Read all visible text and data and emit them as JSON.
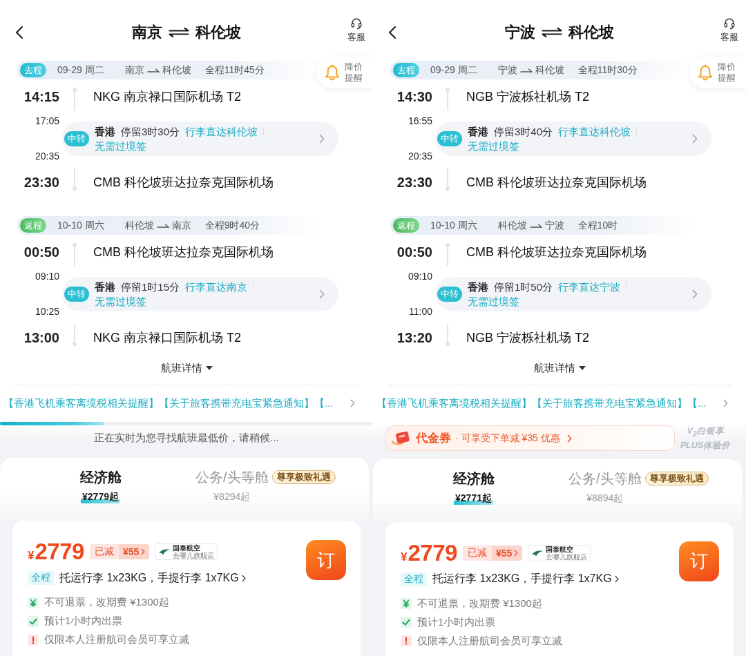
{
  "panels": [
    {
      "header": {
        "origin": "南京",
        "destination": "科伦坡",
        "service_label": "客服"
      },
      "price_alert": {
        "label": "降价提醒"
      },
      "legs": [
        {
          "kind": "outbound",
          "tag": "去程",
          "date": "09-29 周二",
          "route_from": "南京",
          "route_to": "科伦坡",
          "duration": "全程11时45分",
          "departure": {
            "time": "14:15",
            "airport": "NKG 南京禄口国际机场 T2"
          },
          "transfer": {
            "badge": "中转",
            "arrive_time": "17:05",
            "depart_time": "20:35",
            "city": "香港",
            "stay": "停留3时30分",
            "notes": [
              "行李直达科伦坡",
              "无需过境签"
            ]
          },
          "arrival": {
            "time": "23:30",
            "airport": "CMB 科伦坡班达拉奈克国际机场"
          }
        },
        {
          "kind": "return",
          "tag": "返程",
          "date": "10-10 周六",
          "route_from": "科伦坡",
          "route_to": "南京",
          "duration": "全程9时40分",
          "departure": {
            "time": "00:50",
            "airport": "CMB 科伦坡班达拉奈克国际机场"
          },
          "transfer": {
            "badge": "中转",
            "arrive_time": "09:10",
            "depart_time": "10:25",
            "city": "香港",
            "stay": "停留1时15分",
            "notes": [
              "行李直达南京",
              "无需过境签"
            ]
          },
          "arrival": {
            "time": "13:00",
            "airport": "NKG 南京禄口国际机场 T2"
          }
        }
      ],
      "details_link": "航班详情",
      "notice": "【香港飞机乘客离境税相关提醒】【关于旅客携带充电宝紧急通知】【...",
      "status": {
        "kind": "loading",
        "level": 0.28,
        "message": "正在实时为您寻找航班最低价，请稍候..."
      },
      "cabins": [
        {
          "name": "经济舱",
          "price": "¥2779起",
          "selected": true
        },
        {
          "name": "公务/头等舱",
          "price": "¥8294起",
          "selected": false,
          "badge": "尊享极致礼遇"
        }
      ],
      "fare": {
        "currency": "¥",
        "amount": "2779",
        "discount_label": "已减",
        "discount_amount": "¥55",
        "airline": "国泰航空",
        "store": "去哪儿旗舰店",
        "book_label": "订",
        "baggage_scope": "全程",
        "baggage": "托运行李 1x23KG，手提行李 1x7KG",
        "rules": [
          {
            "kind": "refund",
            "text": "不可退票，改期费 ¥1300起"
          },
          {
            "kind": "ticketing",
            "text": "预计1小时内出票"
          },
          {
            "kind": "notice",
            "text": "仅限本人注册航司会员可享立减"
          }
        ]
      }
    },
    {
      "header": {
        "origin": "宁波",
        "destination": "科伦坡",
        "service_label": "客服"
      },
      "price_alert": {
        "label": "降价提醒"
      },
      "legs": [
        {
          "kind": "outbound",
          "tag": "去程",
          "date": "09-29 周二",
          "route_from": "宁波",
          "route_to": "科伦坡",
          "duration": "全程11时30分",
          "departure": {
            "time": "14:30",
            "airport": "NGB 宁波栎社机场 T2"
          },
          "transfer": {
            "badge": "中转",
            "arrive_time": "16:55",
            "depart_time": "20:35",
            "city": "香港",
            "stay": "停留3时40分",
            "notes": [
              "行李直达科伦坡",
              "无需过境签"
            ]
          },
          "arrival": {
            "time": "23:30",
            "airport": "CMB 科伦坡班达拉奈克国际机场"
          }
        },
        {
          "kind": "return",
          "tag": "返程",
          "date": "10-10 周六",
          "route_from": "科伦坡",
          "route_to": "宁波",
          "duration": "全程10时",
          "departure": {
            "time": "00:50",
            "airport": "CMB 科伦坡班达拉奈克国际机场"
          },
          "transfer": {
            "badge": "中转",
            "arrive_time": "09:10",
            "depart_time": "11:00",
            "city": "香港",
            "stay": "停留1时50分",
            "notes": [
              "行李直达宁波",
              "无需过境签"
            ]
          },
          "arrival": {
            "time": "13:20",
            "airport": "NGB 宁波栎社机场 T2"
          }
        }
      ],
      "details_link": "航班详情",
      "notice": "【香港飞机乘客离境税相关提醒】【关于旅客携带充电宝紧急通知】【...",
      "status": {
        "kind": "voucher",
        "title": "代金券",
        "text": "· 可享受下单减 ¥35 优惠",
        "member_tier": "V$_{2}$白银享",
        "member_offer": "PLUS体验价"
      },
      "cabins": [
        {
          "name": "经济舱",
          "price": "¥2771起",
          "selected": true
        },
        {
          "name": "公务/头等舱",
          "price": "¥8894起",
          "selected": false,
          "badge": "尊享极致礼遇"
        }
      ],
      "fare": {
        "currency": "¥",
        "amount": "2779",
        "discount_label": "已减",
        "discount_amount": "¥55",
        "airline": "国泰航空",
        "store": "去哪儿旗舰店",
        "book_label": "订",
        "baggage_scope": "全程",
        "baggage": "托运行李 1x23KG，手提行李 1x7KG",
        "rules": [
          {
            "kind": "refund",
            "text": "不可退票，改期费 ¥1300起"
          },
          {
            "kind": "ticketing",
            "text": "预计1小时内出票"
          },
          {
            "kind": "notice",
            "text": "仅限本人注册航司会员可享立减"
          }
        ]
      }
    }
  ]
}
